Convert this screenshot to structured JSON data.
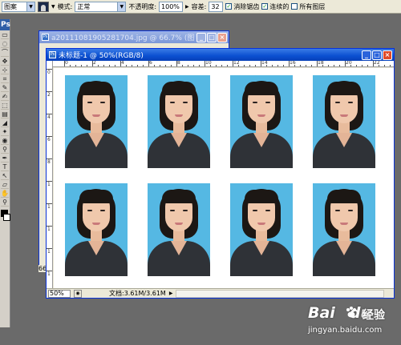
{
  "options_bar": {
    "fill_source": "图案",
    "mode_label": "模式:",
    "mode_value": "正常",
    "opacity_label": "不透明度:",
    "opacity_value": "100%",
    "tolerance_label": "容差:",
    "tolerance_value": "32",
    "antialias_label": "消除锯齿",
    "contiguous_label": "连续的",
    "all_layers_label": "所有图层"
  },
  "toolbox": {
    "logo": "Ps",
    "tools": [
      "▭",
      "◌",
      "⌒",
      "✥",
      "⊹",
      "⌗",
      "✎",
      "✍",
      "⬚",
      "▤",
      "◢",
      "✦",
      "◉",
      "⚲",
      "✒",
      "T",
      "↖",
      "▱",
      "✋",
      "⚲"
    ],
    "foreground": "#000000",
    "background": "#ffffff"
  },
  "back_window": {
    "title": "a20111081905281704.jpg @ 66.7% (图..."
  },
  "front_window": {
    "title": "未标题-1 @ 50%(RGB/8)",
    "zoom": "50%",
    "doc_info": "文档:3.61M/3.61M",
    "ruler_h_labels": [
      "0",
      "2",
      "4",
      "6",
      "8",
      "10",
      "12",
      "14",
      "16",
      "18",
      "20",
      "22"
    ],
    "ruler_v_labels": [
      "0",
      "2",
      "4",
      "6",
      "8",
      "1",
      "1",
      "1",
      "1",
      "1"
    ],
    "photos": [
      {
        "label": "id-photo-1"
      },
      {
        "label": "id-photo-2"
      },
      {
        "label": "id-photo-3"
      },
      {
        "label": "id-photo-4"
      },
      {
        "label": "id-photo-5"
      },
      {
        "label": "id-photo-6"
      },
      {
        "label": "id-photo-7"
      },
      {
        "label": "id-photo-8"
      }
    ]
  },
  "left_edge_number": "66",
  "watermark": {
    "brand": "Bai",
    "brand_tail": "du",
    "experience": "经验",
    "url": "jingyan.baidu.com"
  },
  "colors": {
    "photo_background": "#55b8e3",
    "title_active": "#0a4fd0",
    "workspace": "#6a6a6a"
  }
}
